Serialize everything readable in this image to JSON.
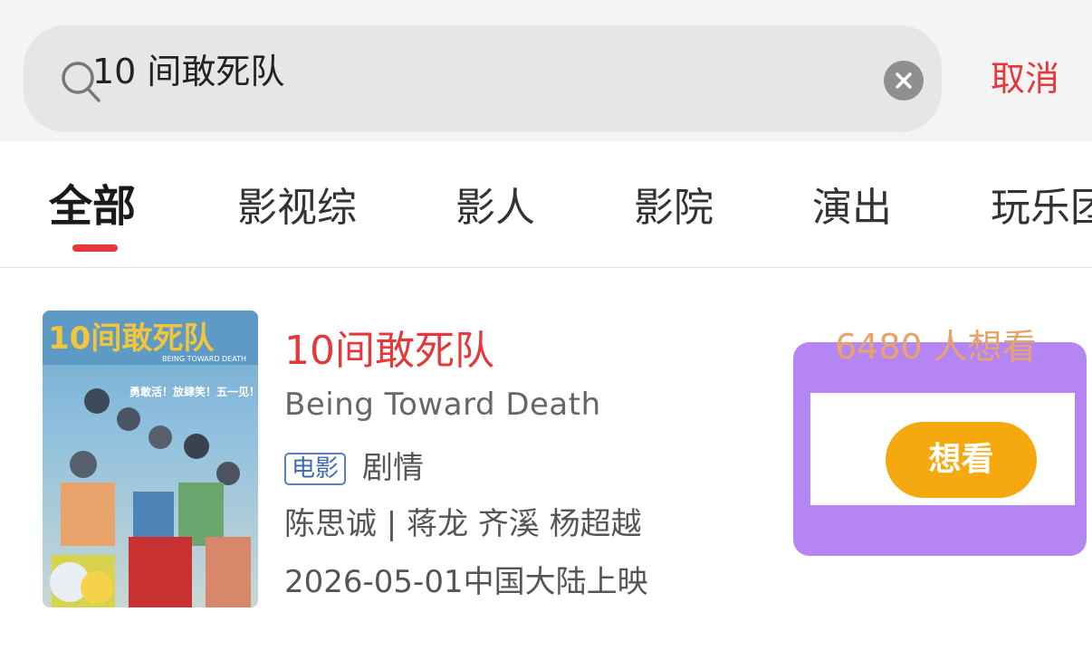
{
  "search": {
    "query": "10 间敢死队",
    "search_icon": "search-icon",
    "clear_icon": "close-circle-icon",
    "cancel_label": "取消"
  },
  "tabs": [
    {
      "label": "全部",
      "active": true
    },
    {
      "label": "影视综",
      "active": false
    },
    {
      "label": "影人",
      "active": false
    },
    {
      "label": "影院",
      "active": false
    },
    {
      "label": "演出",
      "active": false
    },
    {
      "label": "玩乐团",
      "active": false
    }
  ],
  "movie": {
    "title": "10间敢死队",
    "english_title": "Being Toward Death",
    "type_badge": "电影",
    "genre": "剧情",
    "cast": "陈思诚 | 蒋龙 齐溪 杨超越",
    "release": "2026-05-01中国大陆上映",
    "want_count": "6480 人想看",
    "want_button_label": "想看",
    "poster": {
      "title_text": "10间敢死队",
      "subtitle_text": "BEING TOWARD DEATH",
      "slogan_text": "勇敢活！放肆笑！五一见！"
    }
  },
  "colors": {
    "accent_red": "#e5383b",
    "want_button": "#f5a90f",
    "want_count": "#e7a46a",
    "badge_blue": "#3d68b5",
    "highlight": "#a064f0"
  }
}
